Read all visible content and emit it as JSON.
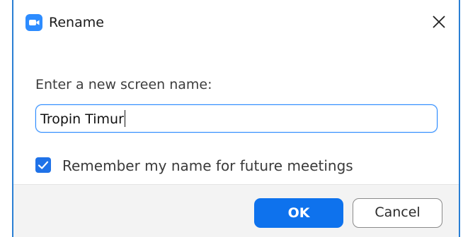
{
  "window": {
    "title": "Rename",
    "app_icon": "zoom-camera-icon",
    "close_icon": "close-icon"
  },
  "form": {
    "prompt": "Enter a new screen name:",
    "name_value": "Tropin Timur",
    "remember_label": "Remember my name for future meetings",
    "remember_checked": true
  },
  "buttons": {
    "ok_label": "OK",
    "cancel_label": "Cancel"
  },
  "colors": {
    "accent": "#0e72ed",
    "app_icon_bg": "#2d8cff",
    "footer_bg": "#f3f3f3"
  }
}
